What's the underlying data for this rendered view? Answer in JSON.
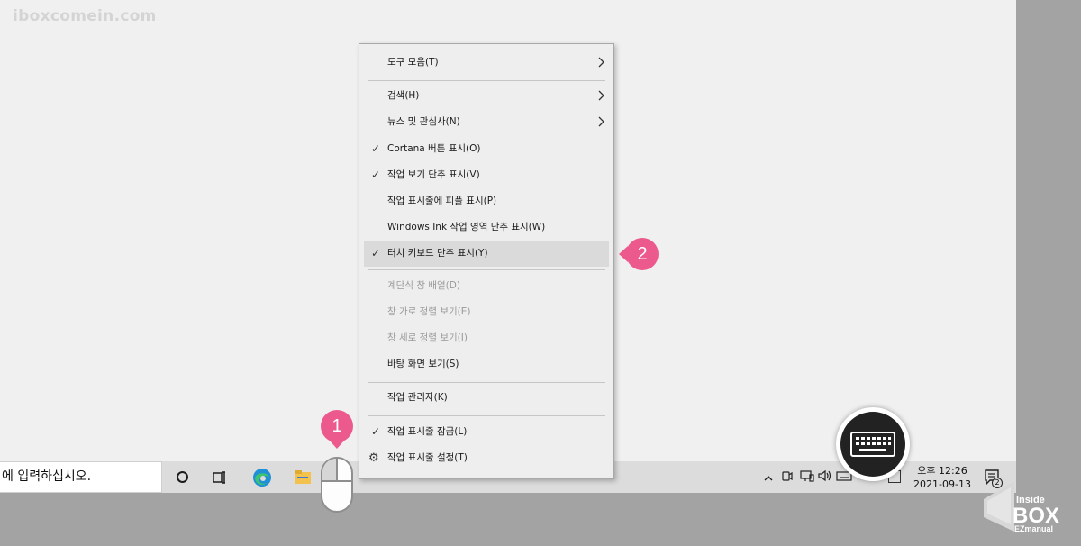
{
  "watermark": "iboxcomein.com",
  "menu": {
    "items": [
      {
        "label": "도구 모음(T)",
        "checked": false,
        "submenu": true,
        "disabled": false
      },
      {
        "label": "검색(H)",
        "checked": false,
        "submenu": true,
        "disabled": false
      },
      {
        "label": "뉴스 및 관심사(N)",
        "checked": false,
        "submenu": true,
        "disabled": false
      },
      {
        "label": "Cortana 버튼 표시(O)",
        "checked": true,
        "submenu": false,
        "disabled": false
      },
      {
        "label": "작업 보기 단추 표시(V)",
        "checked": true,
        "submenu": false,
        "disabled": false
      },
      {
        "label": "작업 표시줄에 피플 표시(P)",
        "checked": false,
        "submenu": false,
        "disabled": false
      },
      {
        "label": "Windows Ink 작업 영역 단추 표시(W)",
        "checked": false,
        "submenu": false,
        "disabled": false
      },
      {
        "label": "터치 키보드 단추 표시(Y)",
        "checked": true,
        "submenu": false,
        "disabled": false,
        "highlighted": true
      },
      {
        "label": "계단식 창 배열(D)",
        "checked": false,
        "submenu": false,
        "disabled": true
      },
      {
        "label": "창 가로 정렬 보기(E)",
        "checked": false,
        "submenu": false,
        "disabled": true
      },
      {
        "label": "창 세로 정렬 보기(I)",
        "checked": false,
        "submenu": false,
        "disabled": true
      },
      {
        "label": "바탕 화면 보기(S)",
        "checked": false,
        "submenu": false,
        "disabled": false
      },
      {
        "label": "작업 관리자(K)",
        "checked": false,
        "submenu": false,
        "disabled": false
      },
      {
        "label": "작업 표시줄 잠금(L)",
        "checked": true,
        "submenu": false,
        "disabled": false
      },
      {
        "label": "작업 표시줄 설정(T)",
        "checked": false,
        "submenu": false,
        "disabled": false,
        "icon": "gear-icon"
      }
    ]
  },
  "taskbar": {
    "search_text": "에 입력하십시오.",
    "icons": [
      "cortana-icon",
      "task-view-icon",
      "edge-icon",
      "file-explorer-icon"
    ],
    "tray_icons": [
      "chevron-up-icon",
      "meet-now-icon",
      "network-icon",
      "volume-icon",
      "touch-keyboard-icon",
      "ime-icon"
    ],
    "clock": {
      "time": "오후 12:26",
      "date": "2021-09-13"
    },
    "notification_count": "2"
  },
  "callouts": {
    "step1": "1",
    "step2": "2"
  },
  "logo": {
    "line1": "Inside",
    "line2": "BOX",
    "line3": "EZmanual"
  },
  "colors": {
    "badge": "#ec5a8d",
    "menu_bg": "#eeeeee",
    "highlight": "#dadada",
    "taskbar": "#dcdcdc"
  }
}
